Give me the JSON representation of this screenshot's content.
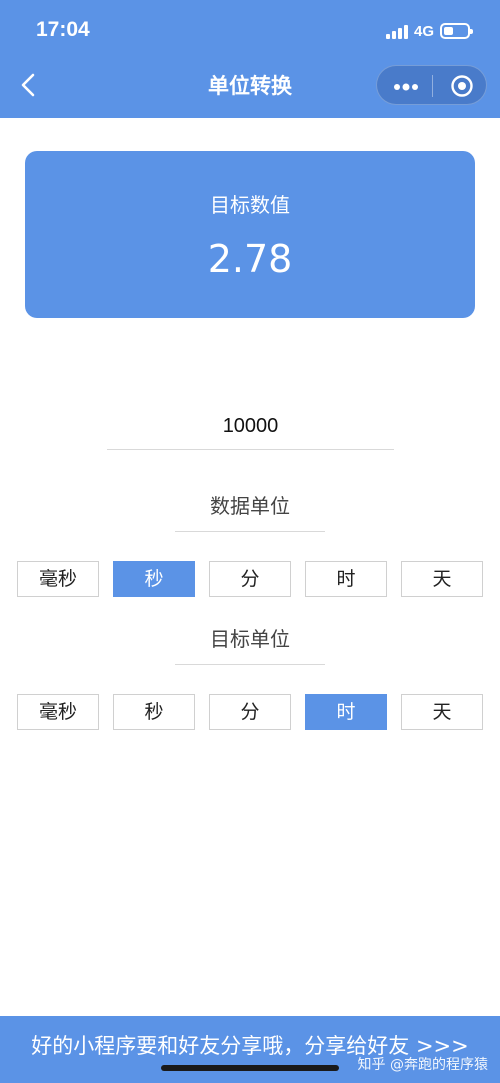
{
  "status_bar": {
    "time": "17:04",
    "network": "4G"
  },
  "nav": {
    "title": "单位转换"
  },
  "result": {
    "label": "目标数值",
    "value": "2.78"
  },
  "input": {
    "value": "10000"
  },
  "source_unit": {
    "label": "数据单位",
    "options": [
      "毫秒",
      "秒",
      "分",
      "时",
      "天"
    ],
    "selected": "秒"
  },
  "target_unit": {
    "label": "目标单位",
    "options": [
      "毫秒",
      "秒",
      "分",
      "时",
      "天"
    ],
    "selected": "时"
  },
  "banner": {
    "text": "好的小程序要和好友分享哦，分享给好友 >>>",
    "watermark": "知乎 @奔跑的程序猿"
  },
  "colors": {
    "accent": "#5b93e6",
    "border": "#d0d0d0"
  },
  "icons": [
    "back-icon",
    "more-icon",
    "target-icon",
    "signal-icon",
    "battery-icon"
  ]
}
